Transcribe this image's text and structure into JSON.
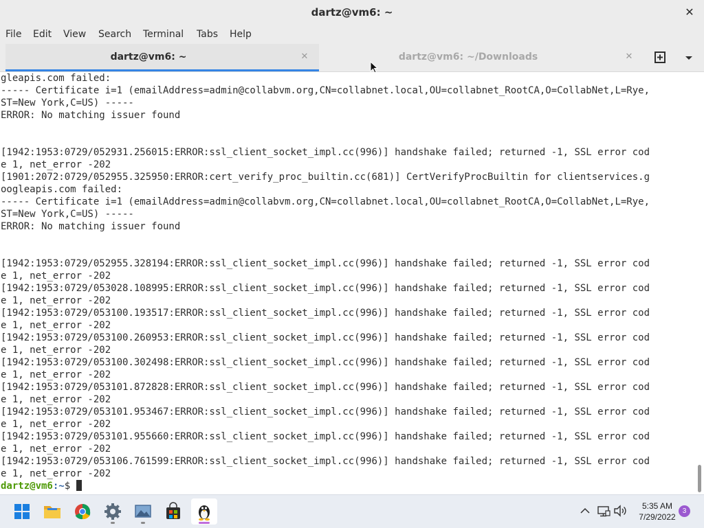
{
  "window": {
    "title": "dartz@vm6: ~"
  },
  "menu": [
    "File",
    "Edit",
    "View",
    "Search",
    "Terminal",
    "Tabs",
    "Help"
  ],
  "tabs": [
    {
      "label": "dartz@vm6: ~",
      "active": true
    },
    {
      "label": "dartz@vm6: ~/Downloads",
      "active": false
    }
  ],
  "terminal": {
    "lines": [
      "gleapis.com failed:",
      "----- Certificate i=1 (emailAddress=admin@collabvm.org,CN=collabnet.local,OU=collabnet_RootCA,O=CollabNet,L=Rye,",
      "ST=New York,C=US) -----",
      "ERROR: No matching issuer found",
      "",
      "",
      "[1942:1953:0729/052931.256015:ERROR:ssl_client_socket_impl.cc(996)] handshake failed; returned -1, SSL error cod",
      "e 1, net_error -202",
      "[1901:2072:0729/052955.325950:ERROR:cert_verify_proc_builtin.cc(681)] CertVerifyProcBuiltin for clientservices.g",
      "oogleapis.com failed:",
      "----- Certificate i=1 (emailAddress=admin@collabvm.org,CN=collabnet.local,OU=collabnet_RootCA,O=CollabNet,L=Rye,",
      "ST=New York,C=US) -----",
      "ERROR: No matching issuer found",
      "",
      "",
      "[1942:1953:0729/052955.328194:ERROR:ssl_client_socket_impl.cc(996)] handshake failed; returned -1, SSL error cod",
      "e 1, net_error -202",
      "[1942:1953:0729/053028.108995:ERROR:ssl_client_socket_impl.cc(996)] handshake failed; returned -1, SSL error cod",
      "e 1, net_error -202",
      "[1942:1953:0729/053100.193517:ERROR:ssl_client_socket_impl.cc(996)] handshake failed; returned -1, SSL error cod",
      "e 1, net_error -202",
      "[1942:1953:0729/053100.260953:ERROR:ssl_client_socket_impl.cc(996)] handshake failed; returned -1, SSL error cod",
      "e 1, net_error -202",
      "[1942:1953:0729/053100.302498:ERROR:ssl_client_socket_impl.cc(996)] handshake failed; returned -1, SSL error cod",
      "e 1, net_error -202",
      "[1942:1953:0729/053101.872828:ERROR:ssl_client_socket_impl.cc(996)] handshake failed; returned -1, SSL error cod",
      "e 1, net_error -202",
      "[1942:1953:0729/053101.953467:ERROR:ssl_client_socket_impl.cc(996)] handshake failed; returned -1, SSL error cod",
      "e 1, net_error -202",
      "[1942:1953:0729/053101.955660:ERROR:ssl_client_socket_impl.cc(996)] handshake failed; returned -1, SSL error cod",
      "e 1, net_error -202",
      "[1942:1953:0729/053106.761599:ERROR:ssl_client_socket_impl.cc(996)] handshake failed; returned -1, SSL error cod",
      "e 1, net_error -202"
    ],
    "prompt_user": "dartz@vm6",
    "prompt_path": ":~",
    "prompt_symbol": "$ "
  },
  "colors": {
    "accent": "#3584e4",
    "prompt_user": "#4e9a06",
    "prompt_path": "#3465a4",
    "notification_badge": "#9b59d0"
  },
  "taskbar": {
    "apps": [
      {
        "name": "start",
        "icon": "windows-logo-icon"
      },
      {
        "name": "file-explorer",
        "icon": "folder-icon"
      },
      {
        "name": "chrome",
        "icon": "chrome-icon"
      },
      {
        "name": "settings",
        "icon": "gear-icon"
      },
      {
        "name": "photos",
        "icon": "image-icon"
      },
      {
        "name": "store",
        "icon": "store-bag-icon"
      },
      {
        "name": "linux-terminal",
        "icon": "tux-icon"
      }
    ],
    "tray_icons": [
      "chevron-up-icon",
      "network-icon",
      "speaker-icon"
    ],
    "time": "5:35 AM",
    "date": "7/29/2022",
    "notification_count": "3"
  }
}
